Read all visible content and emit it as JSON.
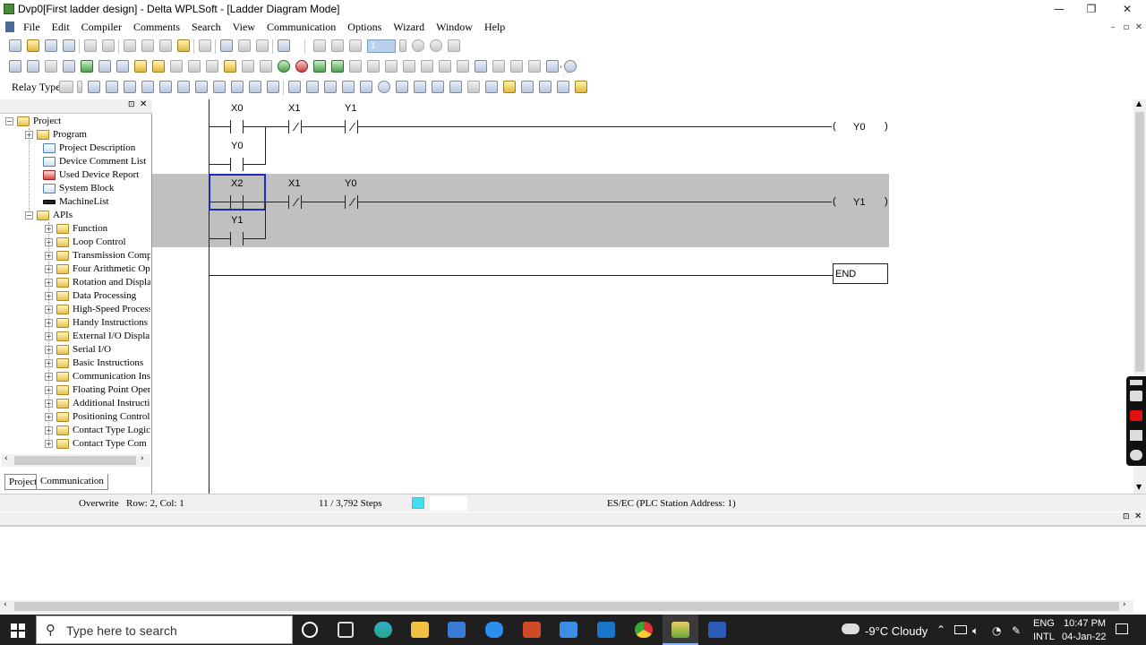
{
  "window": {
    "title": "Dvp0[First ladder design] - Delta WPLSoft - [Ladder Diagram Mode]",
    "minimize": "—",
    "maximize": "❐",
    "close": "✕"
  },
  "menu": [
    {
      "label": "File"
    },
    {
      "label": "Edit"
    },
    {
      "label": "Compiler"
    },
    {
      "label": "Comments"
    },
    {
      "label": "Search"
    },
    {
      "label": "View"
    },
    {
      "label": "Communication"
    },
    {
      "label": "Options"
    },
    {
      "label": "Wizard"
    },
    {
      "label": "Window"
    },
    {
      "label": "Help"
    }
  ],
  "toolbar": {
    "step_value": "1",
    "relay_type_label": "Relay Type"
  },
  "project_tree": {
    "root": "Project",
    "items": [
      {
        "label": "Program"
      },
      {
        "label": "Project Description"
      },
      {
        "label": "Device Comment List"
      },
      {
        "label": "Used Device Report"
      },
      {
        "label": "System Block"
      },
      {
        "label": "MachineList"
      },
      {
        "label": "APIs"
      }
    ],
    "apis": [
      {
        "label": "Function"
      },
      {
        "label": "Loop Control"
      },
      {
        "label": "Transmission Comp"
      },
      {
        "label": "Four Arithmetic Op"
      },
      {
        "label": "Rotation and Displa"
      },
      {
        "label": "Data Processing"
      },
      {
        "label": "High-Speed Process"
      },
      {
        "label": "Handy Instructions"
      },
      {
        "label": "External I/O Displa"
      },
      {
        "label": "Serial I/O"
      },
      {
        "label": "Basic Instructions"
      },
      {
        "label": "Communication Ins"
      },
      {
        "label": "Floating Point Oper"
      },
      {
        "label": "Additional Instructi"
      },
      {
        "label": "Positioning Control"
      },
      {
        "label": "Contact Type Logic"
      },
      {
        "label": "Contact Type Com"
      }
    ],
    "tabs": [
      "Project",
      "Communication"
    ]
  },
  "ladder": {
    "rung1": {
      "contacts": [
        "X0",
        "X1",
        "Y1"
      ],
      "parallel": "Y0",
      "coil": "Y0"
    },
    "rung2": {
      "contacts": [
        "X2",
        "X1",
        "Y0"
      ],
      "parallel": "Y1",
      "coil": "Y1"
    },
    "end_label": "END",
    "coil_open": "(",
    "coil_close": ")"
  },
  "status": {
    "mode": "Overwrite",
    "position": "Row: 2, Col: 1",
    "steps": "11 / 3,792 Steps",
    "station": "ES/EC (PLC Station Address: 1)"
  },
  "taskbar": {
    "search_placeholder": "Type here to search",
    "weather": "-9°C  Cloudy",
    "lang1": "ENG",
    "lang2": "INTL",
    "time": "10:47 PM",
    "date": "04-Jan-22"
  }
}
